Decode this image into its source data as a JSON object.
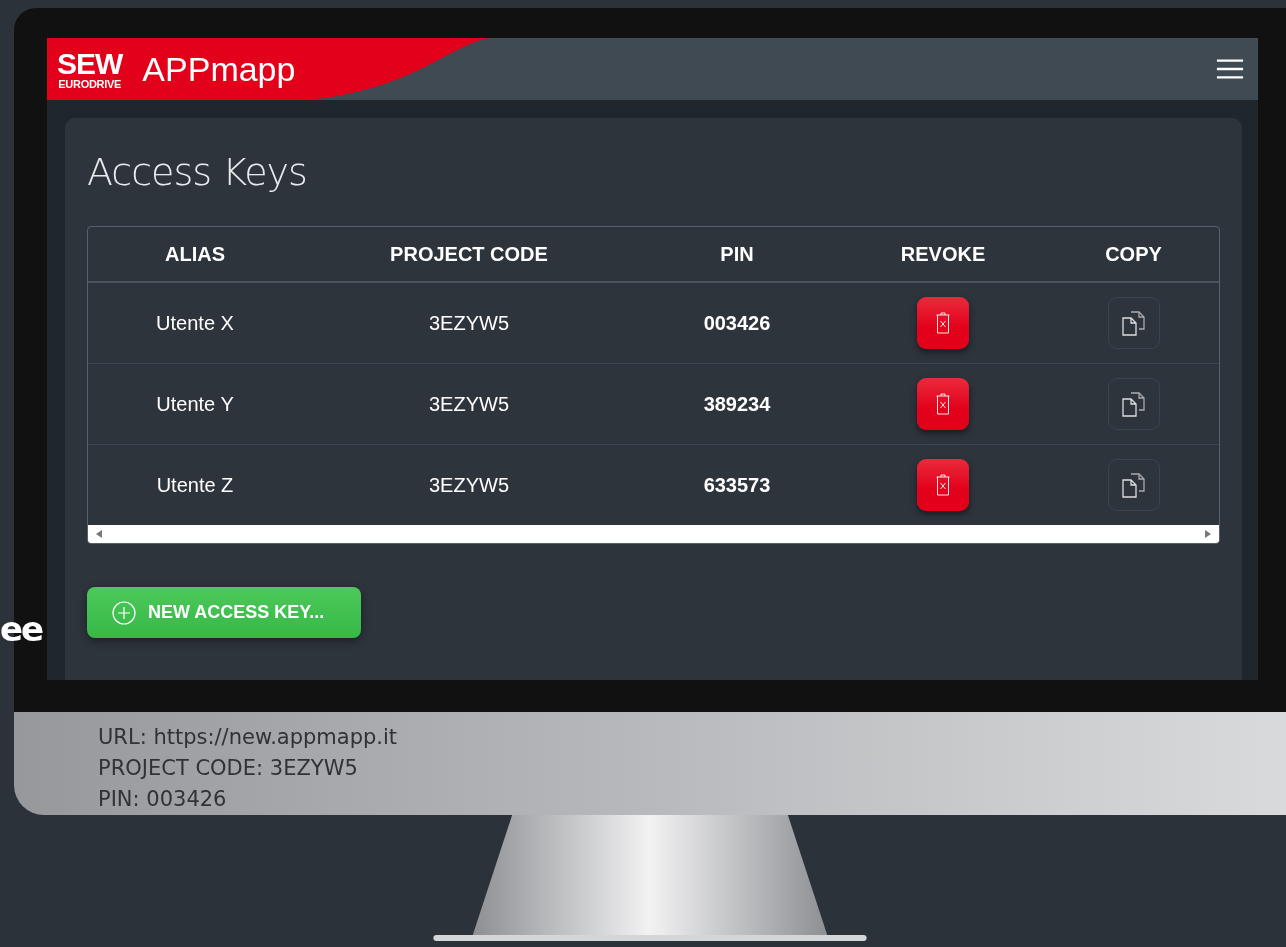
{
  "side_text": "ee",
  "header": {
    "logo_top": "SEW",
    "logo_bottom": "EURODRIVE",
    "app_title": "APPmapp"
  },
  "page_title": "Access Keys",
  "table": {
    "columns": [
      "ALIAS",
      "PROJECT CODE",
      "PIN",
      "REVOKE",
      "COPY"
    ],
    "rows": [
      {
        "alias": "Utente X",
        "project_code": "3EZYW5",
        "pin": "003426"
      },
      {
        "alias": "Utente Y",
        "project_code": "3EZYW5",
        "pin": "389234"
      },
      {
        "alias": "Utente Z",
        "project_code": "3EZYW5",
        "pin": "633573"
      }
    ]
  },
  "new_button": "NEW ACCESS KEY...",
  "monitor_caption": [
    "URL: https://new.appmapp.it",
    "PROJECT CODE: 3EZYW5",
    "PIN: 003426"
  ]
}
